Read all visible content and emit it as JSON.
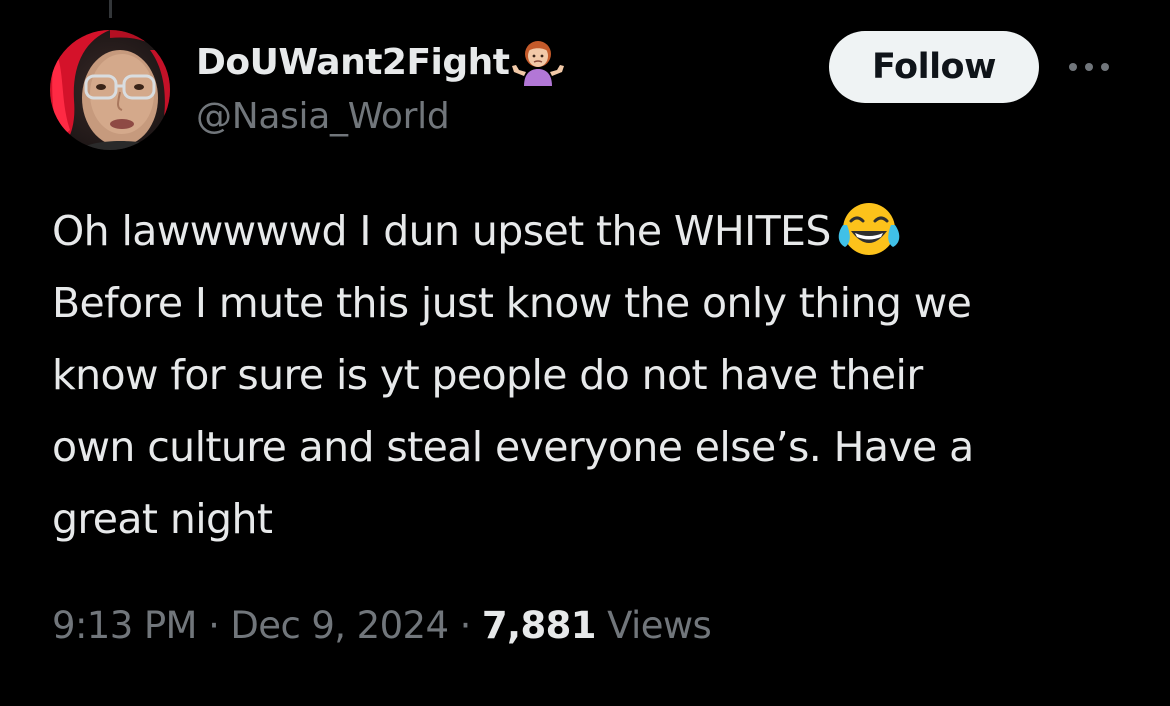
{
  "author": {
    "display_name": "DoUWant2Fight",
    "name_emoji": "person-shrugging-emoji",
    "handle": "@Nasia_World",
    "avatar": "profile-photo-red-hair-glasses"
  },
  "actions": {
    "follow_label": "Follow",
    "more_icon": "more-horizontal-icon"
  },
  "tweet": {
    "lines": [
      "Oh lawwwwwd I dun upset the WHITES",
      "Before I mute this just know the only thing we",
      "know for sure is yt people do not have their",
      "own culture and steal everyone else’s. Have a",
      "great night"
    ],
    "emoji": "face-with-tears-of-joy-emoji"
  },
  "meta": {
    "time": "9:13 PM",
    "separator": "·",
    "date": "Dec 9, 2024",
    "views_count": "7,881",
    "views_label": "Views"
  },
  "colors": {
    "background": "#000000",
    "primary_text": "#e7e9ea",
    "secondary_text": "#71767b",
    "follow_bg": "#eff3f4",
    "follow_text": "#0f1419"
  }
}
